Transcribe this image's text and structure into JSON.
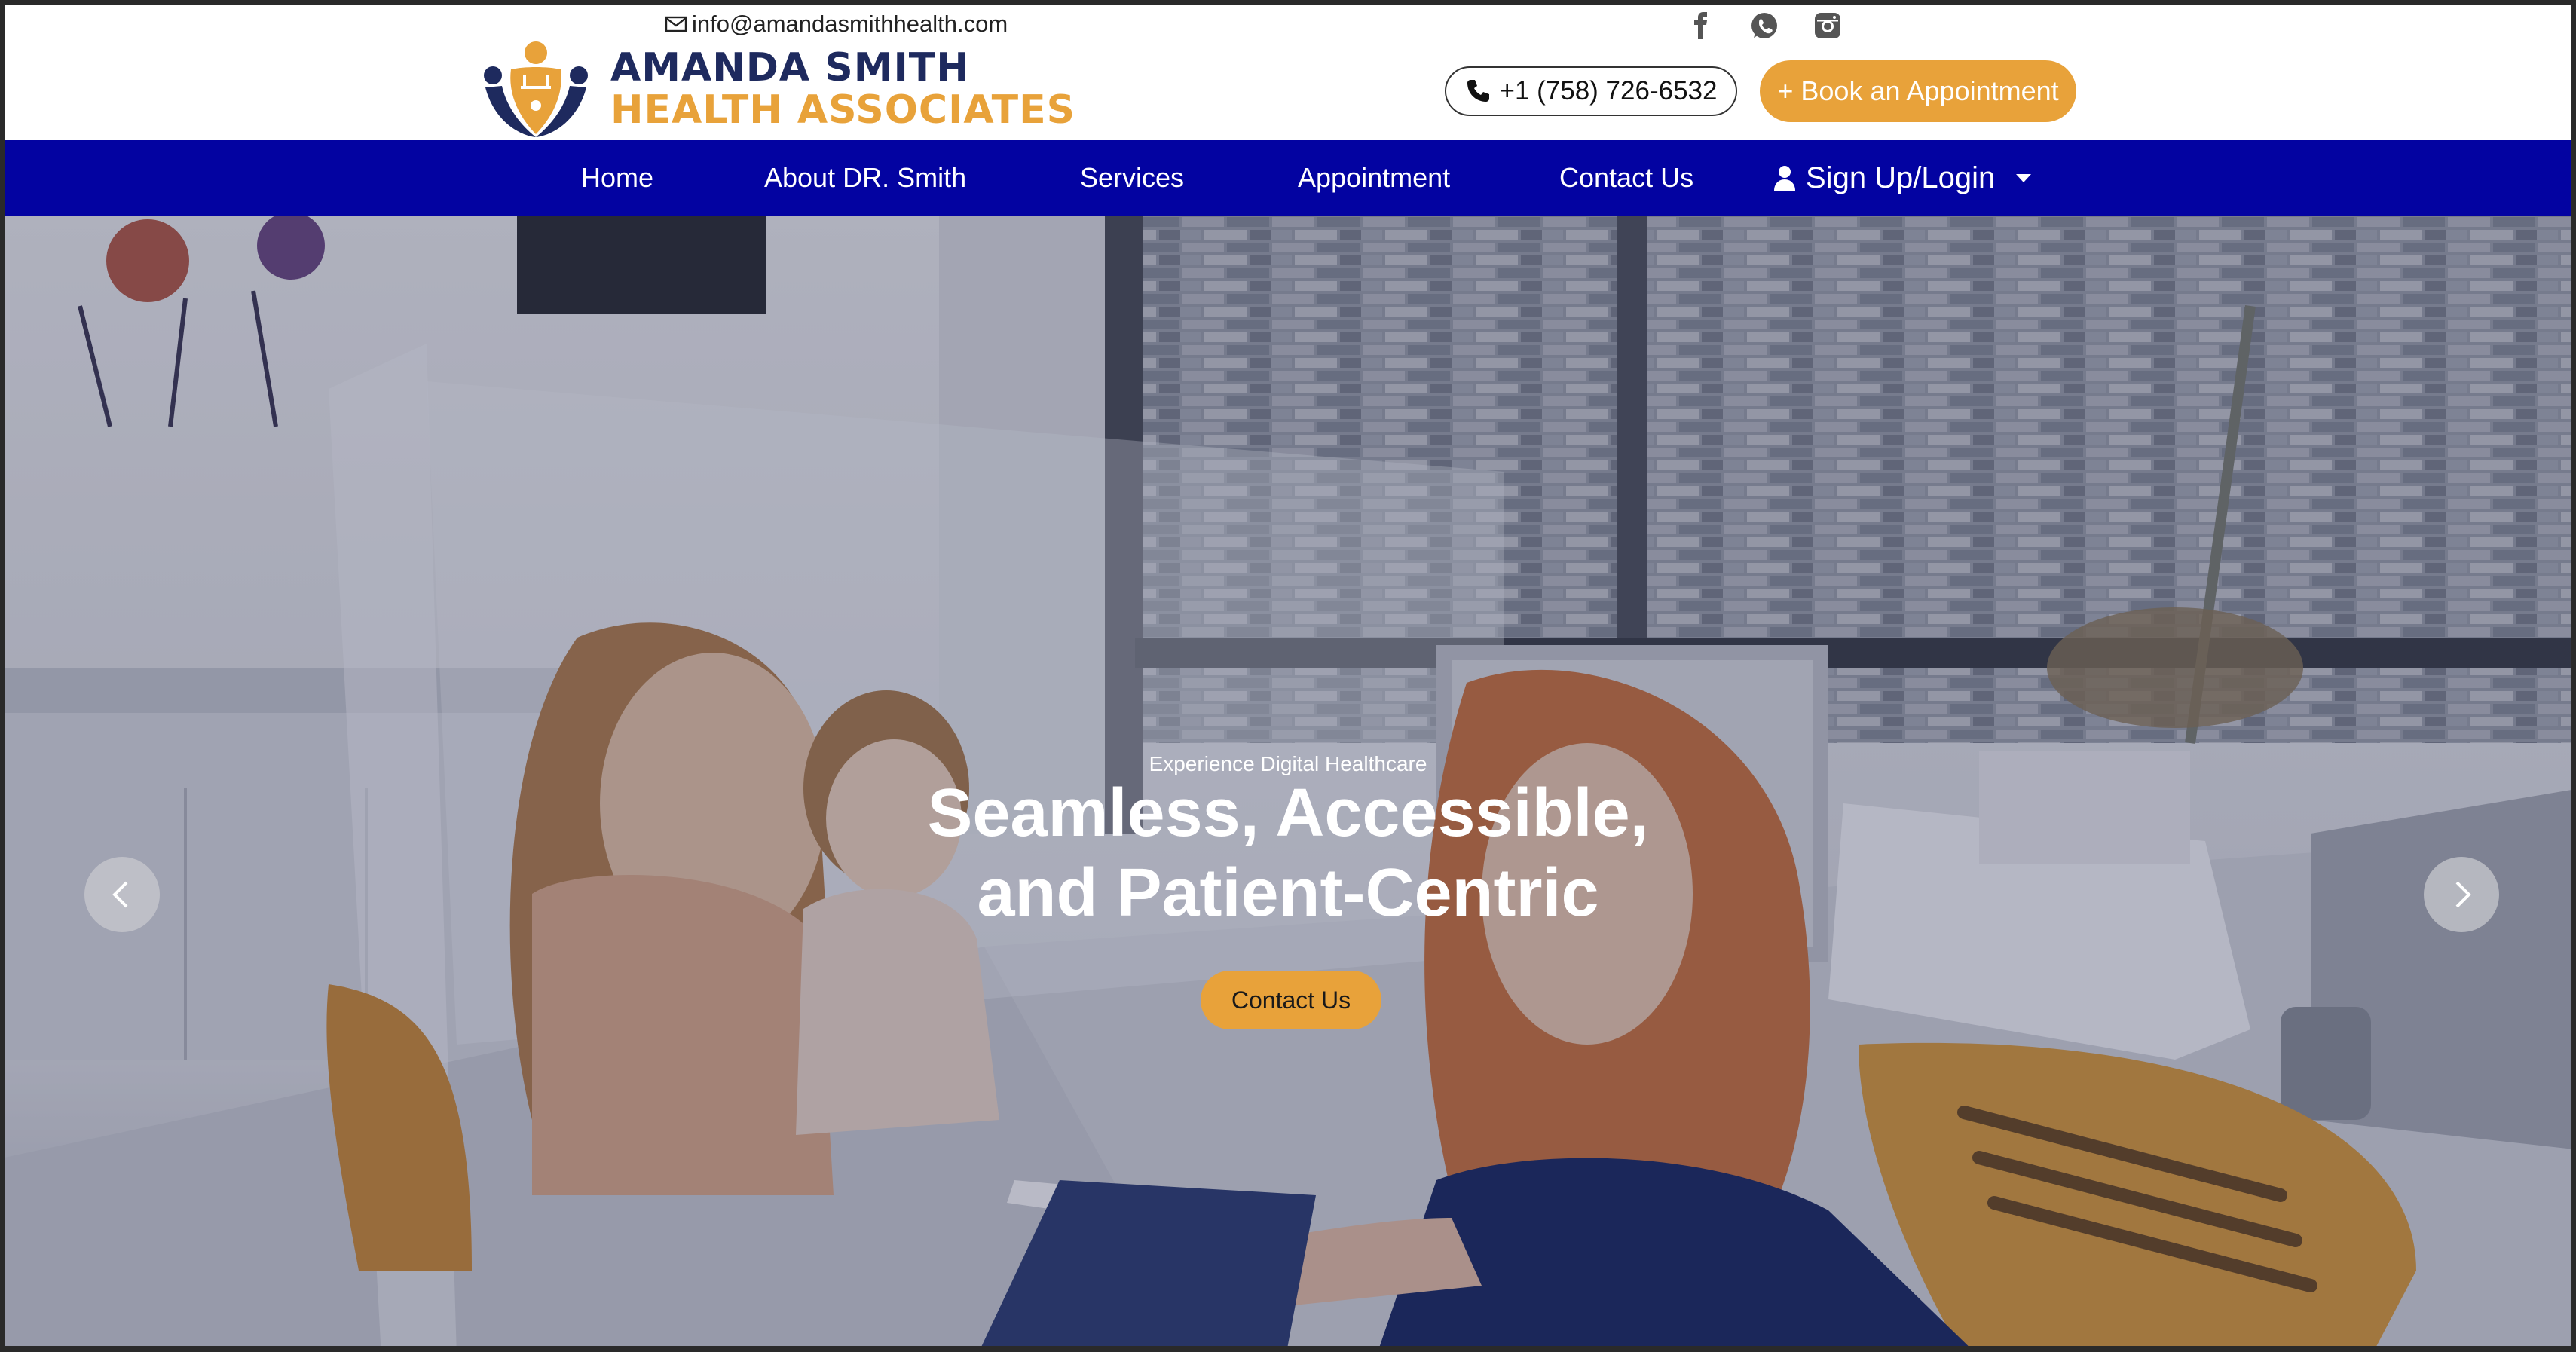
{
  "header": {
    "email": "info@amandasmithhealth.com",
    "logo_line1": "AMANDA SMITH",
    "logo_line2": "HEALTH ASSOCIATES",
    "phone": "+1 (758) 726-6532",
    "book_button": "+ Book an Appointment",
    "social": [
      "facebook-icon",
      "whatsapp-icon",
      "instagram-icon"
    ]
  },
  "nav": {
    "items": [
      {
        "label": "Home"
      },
      {
        "label": "About DR. Smith"
      },
      {
        "label": "Services"
      },
      {
        "label": "Appointment"
      },
      {
        "label": "Contact Us"
      }
    ],
    "login_label": "Sign Up/Login"
  },
  "hero": {
    "kicker": "Experience Digital Healthcare",
    "title_line1": "Seamless, Accessible,",
    "title_line2": "and Patient-Centric",
    "cta": "Contact Us"
  },
  "colors": {
    "nav_bg": "#0303a1",
    "accent": "#e8a23a",
    "brand_dark": "#1e2a5e"
  }
}
